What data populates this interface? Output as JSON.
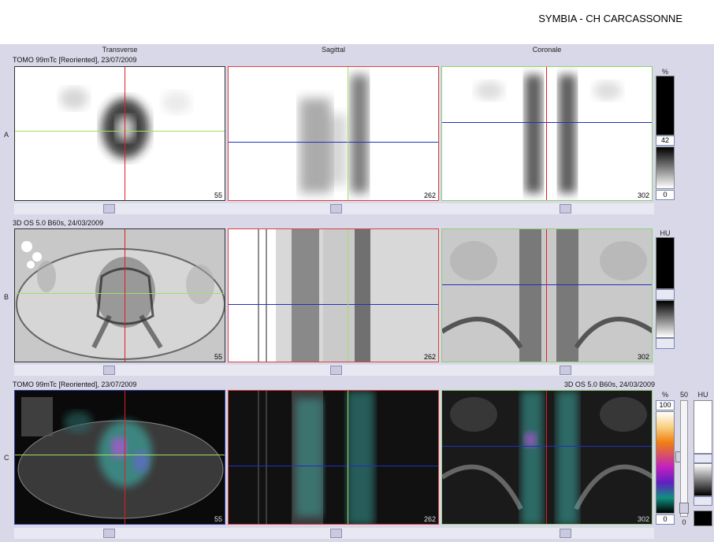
{
  "header": {
    "title": "SYMBIA - CH CARCASSONNE"
  },
  "columns": [
    "Transverse",
    "Sagittal",
    "Coronale"
  ],
  "rows": [
    {
      "label": "A",
      "info_left": "TOMO 99mTc [Reoriented], 23/07/2009",
      "info_right": "",
      "slices": [
        "55",
        "262",
        "302"
      ],
      "colorbar": {
        "unit": "%",
        "value_top": "42",
        "value_bottom": "0"
      }
    },
    {
      "label": "B",
      "info_left": "3D  OS  5.0  B60s, 24/03/2009",
      "info_right": "",
      "slices": [
        "55",
        "262",
        "302"
      ],
      "colorbar": {
        "unit": "HU"
      }
    },
    {
      "label": "C",
      "info_left": "TOMO 99mTc [Reoriented], 23/07/2009",
      "info_right": "3D  OS  5.0  B60s, 24/03/2009",
      "slices": [
        "55",
        "262",
        "302"
      ],
      "colorbar": {
        "unit": "%",
        "value_top": "100",
        "value_bottom": "0",
        "blend_top": "50",
        "blend_bottom": "0",
        "unit2": "HU"
      }
    }
  ],
  "colors": {
    "crosshair_red": "#e02020",
    "crosshair_green": "#9ee060",
    "crosshair_blue": "#2030c0",
    "border_red": "#e04040",
    "border_green": "#90d070",
    "border_blue": "#3040a0"
  }
}
